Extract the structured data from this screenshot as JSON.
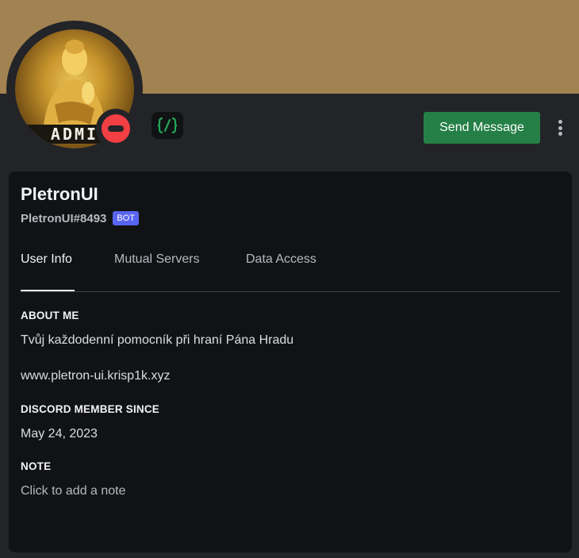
{
  "profile": {
    "avatar_caption": "ADMI",
    "status": "do-not-disturb",
    "badges": [
      "active-developer-icon"
    ],
    "display_name": "PletronUI",
    "tag": "PletronUI#8493",
    "bot_label": "BOT"
  },
  "actions": {
    "send_message_label": "Send Message"
  },
  "tabs": [
    {
      "label": "User Info",
      "active": true
    },
    {
      "label": "Mutual Servers",
      "active": false
    },
    {
      "label": "Data Access",
      "active": false
    }
  ],
  "about": {
    "title": "ABOUT ME",
    "line1": "Tvůj každodenní pomocník při hraní Pána Hradu",
    "line2": "www.pletron-ui.krisp1k.xyz"
  },
  "member_since": {
    "title": "DISCORD MEMBER SINCE",
    "date": "May 24, 2023"
  },
  "note": {
    "title": "NOTE",
    "placeholder": "Click to add a note"
  },
  "colors": {
    "banner": "#a18251",
    "send_button": "#248046",
    "bot_badge": "#5865f2",
    "status_dnd": "#f23f43"
  }
}
